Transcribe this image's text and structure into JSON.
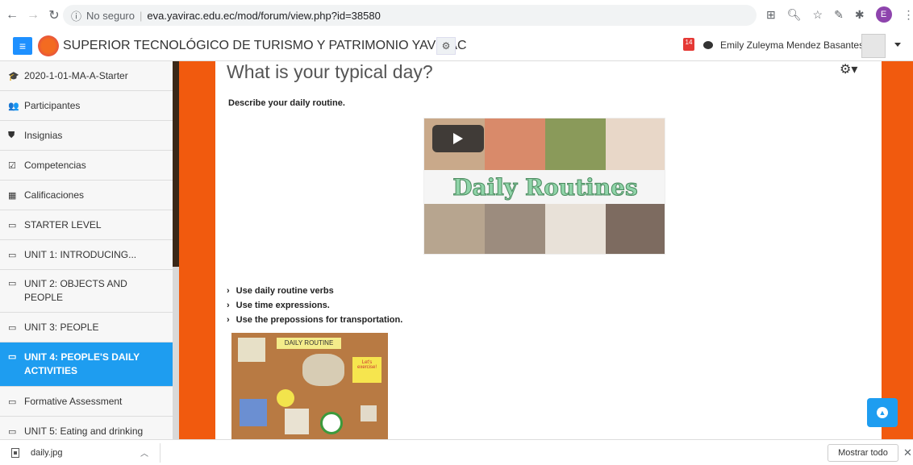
{
  "browser": {
    "security_label": "No seguro",
    "url": "eva.yavirac.edu.ec/mod/forum/view.php?id=38580",
    "profile_initial": "E"
  },
  "navbar": {
    "site_name": "SUPERIOR TECNOLÓGICO DE TURISMO Y PATRIMONIO YAVIRAC",
    "notification_count": "14",
    "user_name": "Emily Zuleyma Mendez Basantes"
  },
  "sidebar": {
    "items": [
      {
        "label": "2020-1-01-MA-A-Starter",
        "icon": "graduation-cap-icon",
        "glyph": "🎓"
      },
      {
        "label": "Participantes",
        "icon": "users-icon",
        "glyph": "👥"
      },
      {
        "label": "Insignias",
        "icon": "shield-icon",
        "glyph": "⛊"
      },
      {
        "label": "Competencias",
        "icon": "checkbox-icon",
        "glyph": "☑"
      },
      {
        "label": "Calificaciones",
        "icon": "table-icon",
        "glyph": "▦"
      },
      {
        "label": "STARTER LEVEL",
        "icon": "folder-icon",
        "glyph": "▭"
      },
      {
        "label": "UNIT 1: INTRODUCING...",
        "icon": "folder-icon",
        "glyph": "▭"
      },
      {
        "label": "UNIT 2: OBJECTS AND PEOPLE",
        "icon": "folder-icon",
        "glyph": "▭"
      },
      {
        "label": "UNIT 3: PEOPLE",
        "icon": "folder-icon",
        "glyph": "▭"
      },
      {
        "label": "UNIT 4: PEOPLE'S DAILY ACTIVITIES",
        "icon": "folder-icon",
        "glyph": "▭"
      },
      {
        "label": "Formative Assessment",
        "icon": "folder-icon",
        "glyph": "▭"
      },
      {
        "label": "UNIT 5: Eating and drinking",
        "icon": "folder-icon",
        "glyph": "▭"
      }
    ]
  },
  "main": {
    "title": "What is your typical day?",
    "description": "Describe your daily routine.",
    "video_title": "Daily Routines",
    "bullets": [
      "Use daily routine verbs",
      "Use time expressions.",
      "Use the prepossions for transportation."
    ],
    "board_title": "DAILY ROUTINE",
    "board_note": "Let's exercise!"
  },
  "downloads": {
    "file_name": "daily.jpg",
    "show_all": "Mostrar todo"
  },
  "colors": {
    "accent": "#1e9df0",
    "brand_orange": "#f15a0e"
  }
}
